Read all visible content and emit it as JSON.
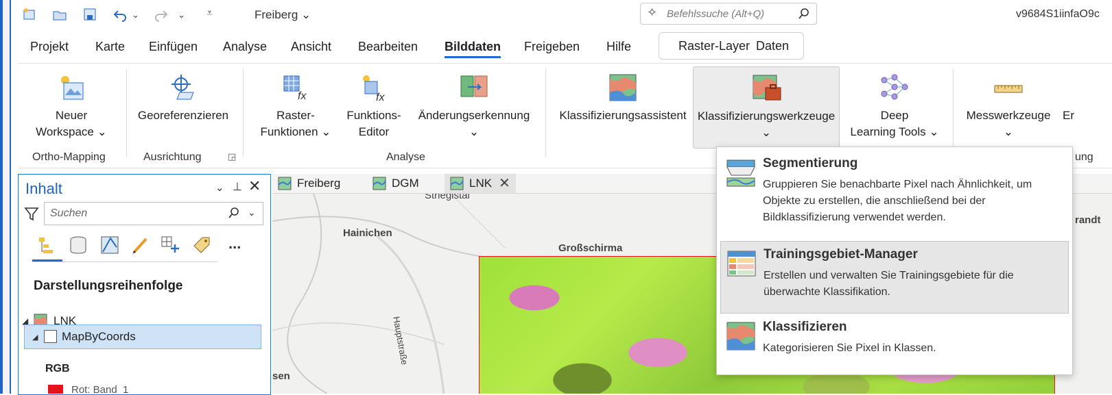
{
  "quick_access": {
    "project_name": "Freiberg",
    "command_search_placeholder": "Befehlssuche (Alt+Q)",
    "user": "v9684S1iinfaO9c"
  },
  "menu": {
    "tabs": [
      "Projekt",
      "Karte",
      "Einfügen",
      "Analyse",
      "Ansicht",
      "Bearbeiten",
      "Bilddaten",
      "Freigeben",
      "Hilfe"
    ],
    "active": "Bilddaten",
    "context_tabs": [
      "Raster-Layer",
      "Daten"
    ]
  },
  "ribbon": {
    "buttons": [
      {
        "line1": "Neuer",
        "line2": "Workspace ⌄"
      },
      {
        "line1": "Georeferenzieren",
        "line2": ""
      },
      {
        "line1": "Raster-",
        "line2": "Funktionen ⌄"
      },
      {
        "line1": "Funktions-",
        "line2": "Editor"
      },
      {
        "line1": "Änderungserkennung",
        "line2": "⌄"
      },
      {
        "line1": "Klassifizierungsassistent",
        "line2": ""
      },
      {
        "line1": "Klassifizierungswerkzeuge",
        "line2": "⌄"
      },
      {
        "line1": "Deep",
        "line2": "Learning Tools ⌄"
      },
      {
        "line1": "Messwerkzeuge",
        "line2": "⌄"
      },
      {
        "line1": "Er",
        "line2": ""
      }
    ],
    "groups": [
      "Ortho-Mapping",
      "Ausrichtung",
      "Analyse",
      "ung"
    ]
  },
  "contents": {
    "title": "Inhalt",
    "search_placeholder": "Suchen",
    "more_label": "...",
    "draw_order_title": "Darstellungsreihenfolge",
    "layer": "LNK",
    "sublayer": "MapByCoords",
    "rgb_label": "RGB",
    "band_label": "Rot:  Band_1"
  },
  "map": {
    "tabs": [
      "Freiberg",
      "DGM",
      "LNK"
    ],
    "active_tab": "LNK",
    "labels": [
      "Striegistal",
      "Hainichen",
      "Großschirma",
      "Hauptstraße",
      "sen",
      "randt"
    ]
  },
  "dropdown": {
    "items": [
      {
        "title": "Segmentierung",
        "desc": "Gruppieren Sie benachbarte Pixel nach Ähnlichkeit, um Objekte zu erstellen, die anschließend bei der Bildklassifizierung verwendet werden."
      },
      {
        "title": "Trainingsgebiet-Manager",
        "desc": "Erstellen und verwalten Sie Trainingsgebiete für die überwachte Klassifikation."
      },
      {
        "title": "Klassifizieren",
        "desc": "Kategorisieren Sie Pixel in Klassen."
      }
    ]
  },
  "colors": {
    "accent": "#2369d6",
    "contents_title": "#1e64be",
    "selection": "#cfe3f7",
    "band_red": "#e8121b"
  }
}
